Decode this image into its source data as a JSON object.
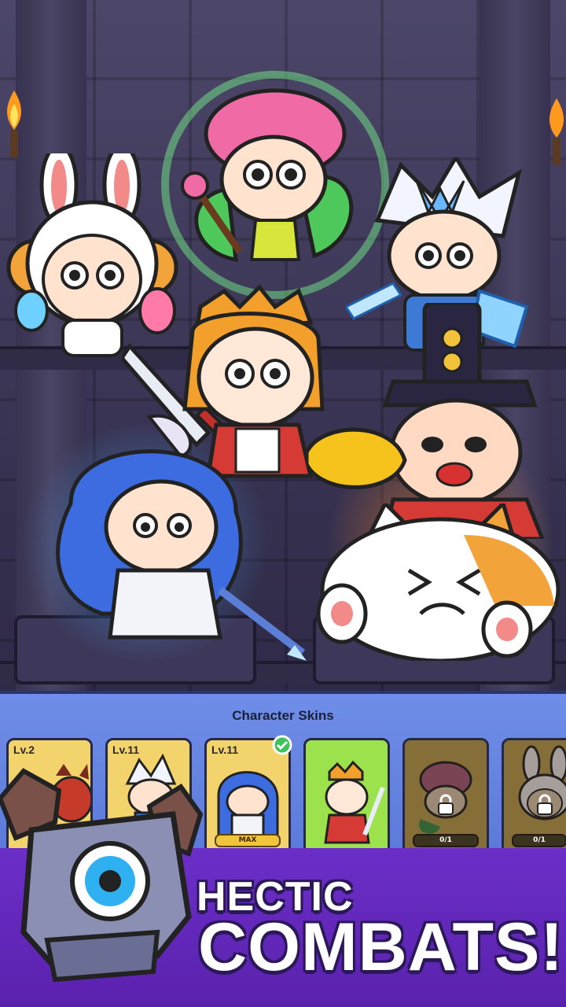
{
  "panel": {
    "title": "Character Skins",
    "cards": [
      {
        "level": "Lv.2",
        "bar": "",
        "state": "owned",
        "color": "#f3d36b"
      },
      {
        "level": "Lv.11",
        "bar": "",
        "state": "owned",
        "color": "#f3d36b"
      },
      {
        "level": "Lv.11",
        "bar": "MAX",
        "state": "selected",
        "color": "#f3d36b"
      },
      {
        "level": "",
        "bar": "",
        "state": "current",
        "color": "#9be24d"
      },
      {
        "level": "",
        "bar": "0/1",
        "state": "locked",
        "color": "#b89a4e"
      },
      {
        "level": "",
        "bar": "0/1",
        "state": "locked",
        "color": "#b89a4e"
      }
    ]
  },
  "slogan": {
    "line1": "HECTIC",
    "line2": "COMBATS!"
  },
  "icons": {
    "check": "check-circle-icon",
    "lock": "lock-icon",
    "shirt": "shirt-icon"
  },
  "colors": {
    "panel_blue": "#6f8ee8",
    "banner_purple": "#6b2fc8",
    "gold": "#f0c43b"
  }
}
